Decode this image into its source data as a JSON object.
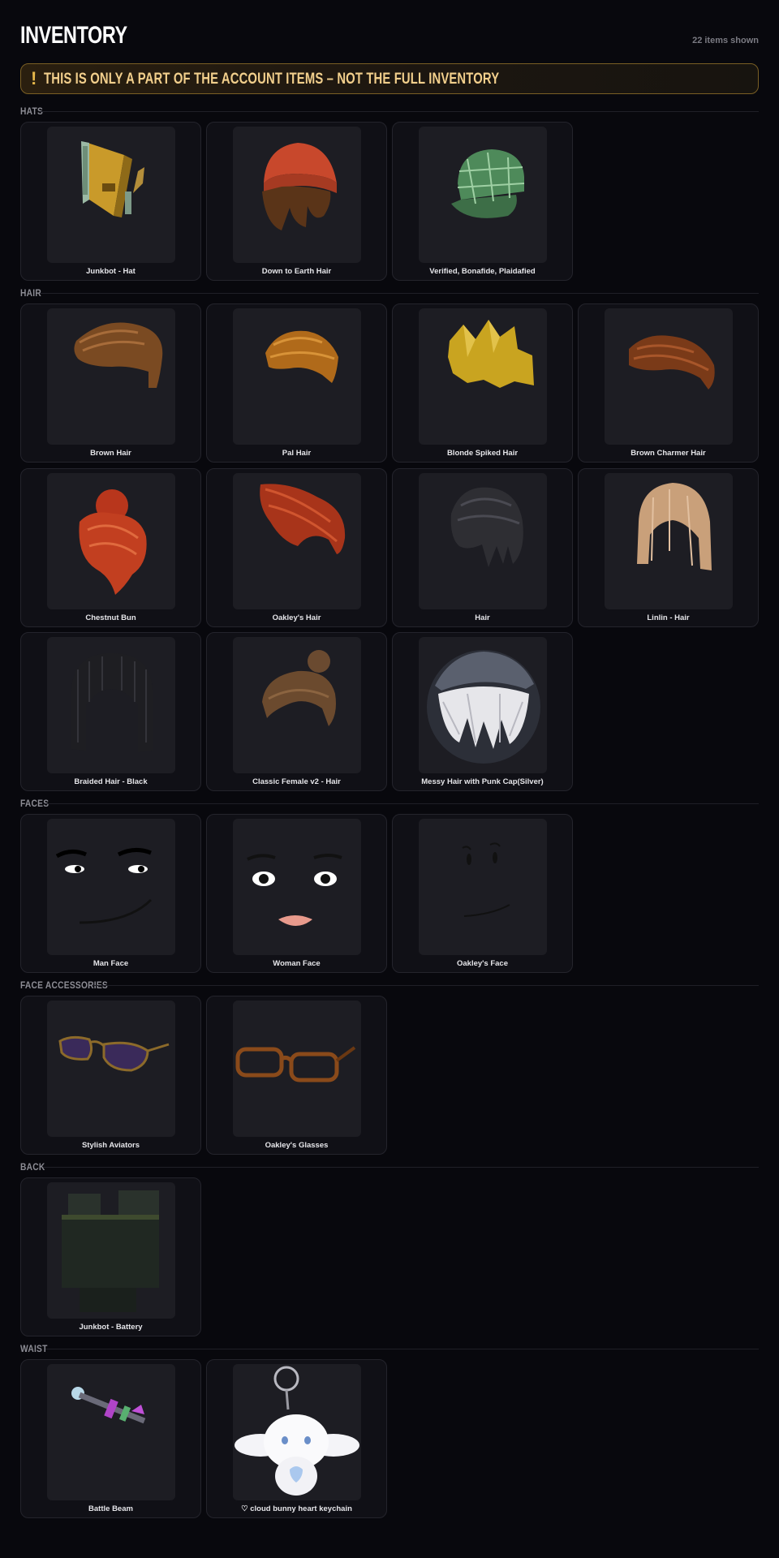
{
  "header": {
    "title": "INVENTORY",
    "count": "22 items shown"
  },
  "banner": {
    "icon": "!",
    "text": "THIS IS ONLY A PART OF THE ACCOUNT ITEMS – NOT THE FULL INVENTORY"
  },
  "sections": {
    "hats": {
      "label": "HATS",
      "items": [
        {
          "name": "Junkbot - Hat",
          "icon": "junkbot-hat-icon"
        },
        {
          "name": "Down to Earth Hair",
          "icon": "beanie-hair-icon"
        },
        {
          "name": "Verified, Bonafide, Plaidafied",
          "icon": "plaid-cap-icon"
        }
      ]
    },
    "hair": {
      "label": "HAIR",
      "items": [
        {
          "name": "Brown Hair",
          "icon": "brown-hair-icon"
        },
        {
          "name": "Pal Hair",
          "icon": "pal-hair-icon"
        },
        {
          "name": "Blonde Spiked Hair",
          "icon": "spiked-hair-icon"
        },
        {
          "name": "Brown Charmer Hair",
          "icon": "charmer-hair-icon"
        },
        {
          "name": "Chestnut Bun",
          "icon": "chestnut-bun-icon"
        },
        {
          "name": "Oakley's Hair",
          "icon": "oakley-hair-icon"
        },
        {
          "name": "Hair",
          "icon": "black-hair-icon"
        },
        {
          "name": "Linlin - Hair",
          "icon": "linlin-hair-icon"
        },
        {
          "name": "Braided Hair - Black",
          "icon": "braided-hair-icon"
        },
        {
          "name": "Classic Female v2 - Hair",
          "icon": "classic-female-hair-icon"
        },
        {
          "name": "Messy Hair with Punk Cap(Silver)",
          "icon": "punk-cap-hair-icon"
        }
      ]
    },
    "faces": {
      "label": "FACES",
      "items": [
        {
          "name": "Man Face",
          "icon": "man-face-icon"
        },
        {
          "name": "Woman Face",
          "icon": "woman-face-icon"
        },
        {
          "name": "Oakley's Face",
          "icon": "oakley-face-icon"
        }
      ]
    },
    "face_accessories": {
      "label": "FACE ACCESSORIES",
      "items": [
        {
          "name": "Stylish Aviators",
          "icon": "aviators-icon"
        },
        {
          "name": "Oakley's Glasses",
          "icon": "glasses-icon"
        }
      ]
    },
    "back": {
      "label": "BACK",
      "items": [
        {
          "name": "Junkbot - Battery",
          "icon": "battery-icon"
        }
      ]
    },
    "waist": {
      "label": "WAIST",
      "items": [
        {
          "name": "Battle Beam",
          "icon": "battle-beam-icon"
        },
        {
          "name": "♡ cloud bunny heart keychain",
          "icon": "bunny-keychain-icon"
        }
      ]
    }
  }
}
